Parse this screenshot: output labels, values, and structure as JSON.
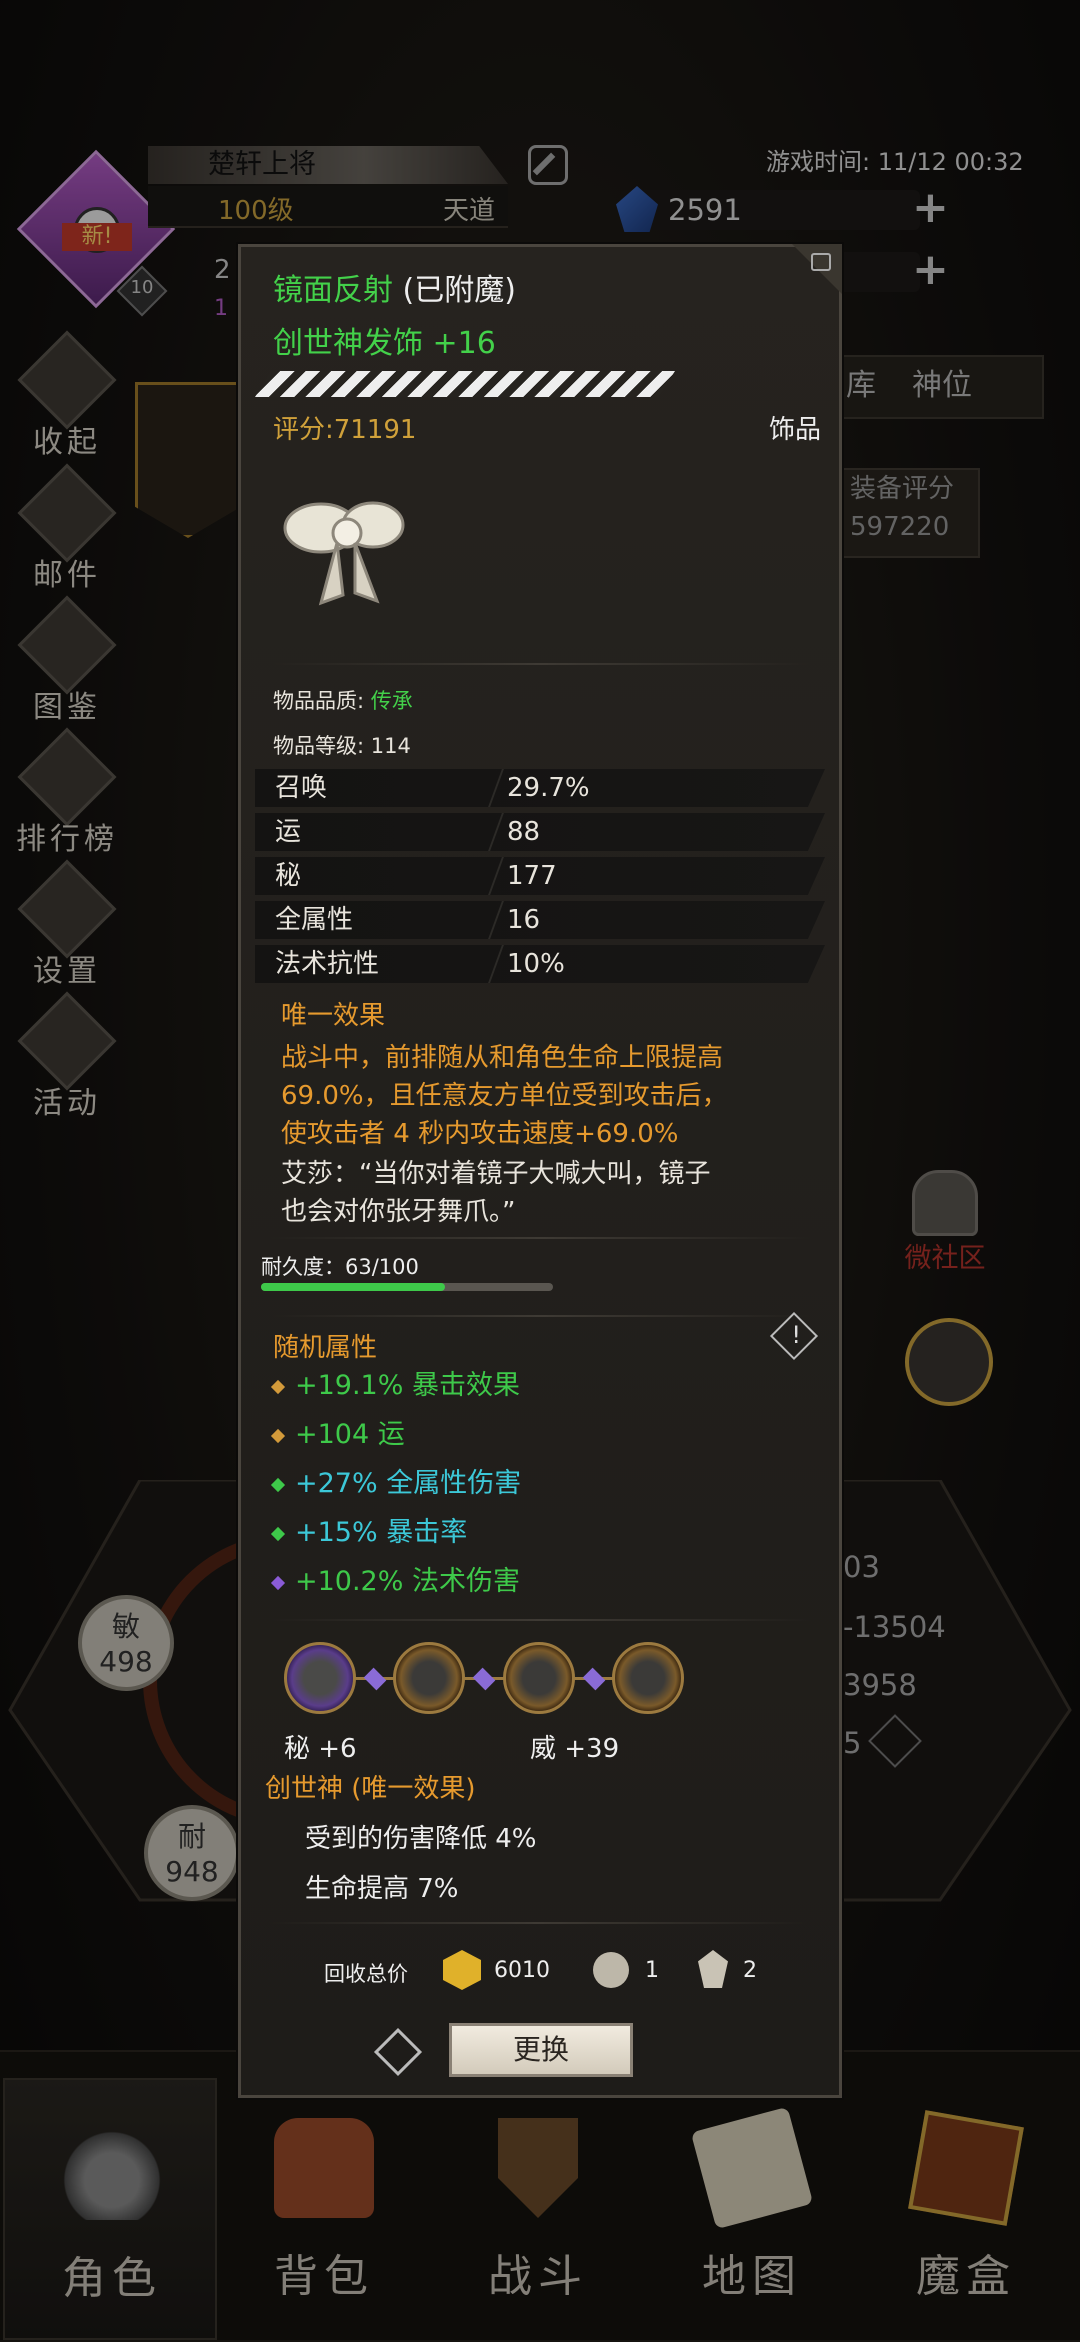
{
  "header": {
    "player_name": "楚轩上将",
    "level": "100级",
    "realm": "天道",
    "avatar_badge": "新!",
    "avatar_small_level": "10",
    "game_time": "游戏时间: 11/12 00:32",
    "gem_count": "2591",
    "partial_left_2": "2",
    "partial_left_1": "1"
  },
  "sidebar": {
    "items": [
      {
        "label": "收起",
        "icon": "collapse-icon"
      },
      {
        "label": "邮件",
        "icon": "mail-icon"
      },
      {
        "label": "图鉴",
        "icon": "book-icon"
      },
      {
        "label": "排行榜",
        "icon": "ranking-icon"
      },
      {
        "label": "设置",
        "icon": "gear-icon"
      },
      {
        "label": "活动",
        "icon": "event-icon"
      }
    ]
  },
  "background_right": {
    "tab_partial_1": "库",
    "tab_partial_2": "神位",
    "score_label": "装备评分",
    "score_value": "597220",
    "community_label": "微社区",
    "stat_a": "03",
    "stat_b": "-13504",
    "stat_c": "3958",
    "stat_d": "5"
  },
  "background_left": {
    "agi_label": "敏",
    "agi_value": "498",
    "end_label": "耐",
    "end_value": "948"
  },
  "item": {
    "name": "镜面反射",
    "enchant_tag": "(已附魔)",
    "subtitle": "创世神发饰 +16",
    "score": "评分:71191",
    "slot_type": "饰品",
    "quality_label": "物品品质:",
    "quality_value": "传承",
    "item_level": "物品等级: 114",
    "stats": [
      {
        "label": "召唤",
        "value": "29.7%"
      },
      {
        "label": "运",
        "value": "88"
      },
      {
        "label": "秘",
        "value": "177"
      },
      {
        "label": "全属性",
        "value": "16"
      },
      {
        "label": "法术抗性",
        "value": "10%"
      }
    ],
    "unique_title": "唯一效果",
    "unique_effect_lines": [
      "战斗中，前排随从和角色生命上限提高",
      "69.0%，且任意友方单位受到攻击后，",
      "使攻击者 4 秒内攻击速度+69.0%"
    ],
    "flavor_lines": [
      "艾莎：“当你对着镜子大喊大叫，镜子",
      "也会对你张牙舞爪。”"
    ],
    "durability": "耐久度：63/100",
    "durability_fraction": 0.63,
    "random_title": "随机属性",
    "random_attrs": [
      {
        "text": "+19.1% 暴击效果",
        "color": "#3ec94a",
        "gem": "#d39a3a"
      },
      {
        "text": "+104 运",
        "color": "#3ec94a",
        "gem": "#d39a3a"
      },
      {
        "text": "+27% 全属性伤害",
        "color": "#3cc8d8",
        "gem": "#3ec94a"
      },
      {
        "text": "+15% 暴击率",
        "color": "#3cc8d8",
        "gem": "#3ec94a"
      },
      {
        "text": "+10.2% 法术伤害",
        "color": "#3ec94a",
        "gem": "#8a5bd6"
      }
    ],
    "socket_bonus_1": "秘 +6",
    "socket_bonus_2": "威 +39",
    "set_title": "创世神 (唯一效果)",
    "set_effects": [
      "受到的伤害降低 4%",
      "生命提高 7%"
    ],
    "recycle_label": "回收总价",
    "recycle_gold": "6010",
    "recycle_item1": "1",
    "recycle_item2": "2",
    "swap_button": "更换"
  },
  "bottom_nav": [
    {
      "label": "角色",
      "icon": "helmet-icon",
      "active": true
    },
    {
      "label": "背包",
      "icon": "backpack-icon",
      "active": false
    },
    {
      "label": "战斗",
      "icon": "sword-shield-icon",
      "active": false
    },
    {
      "label": "地图",
      "icon": "scroll-map-icon",
      "active": false
    },
    {
      "label": "魔盒",
      "icon": "magic-box-icon",
      "active": false
    }
  ],
  "colors": {
    "legendary_green": "#43d14a",
    "gold": "#c9a23f",
    "orange_text": "#e69a2e",
    "cyan": "#3cc8d8"
  }
}
